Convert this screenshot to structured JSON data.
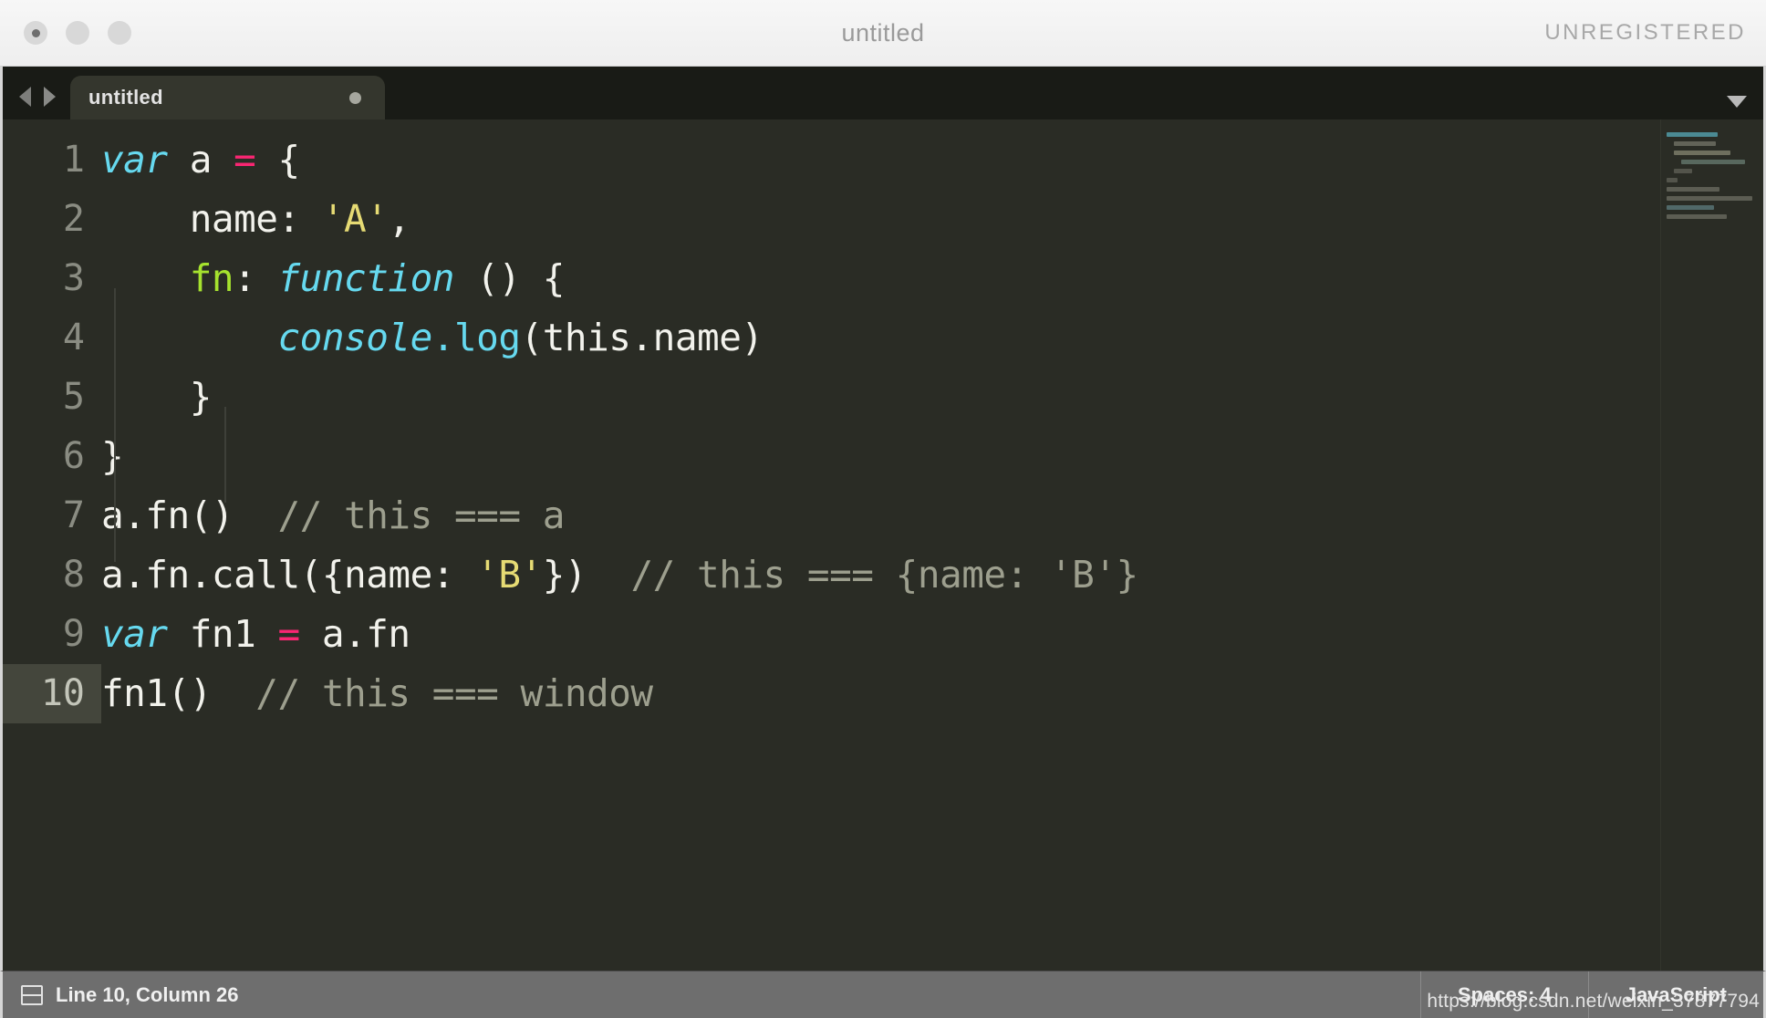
{
  "window": {
    "title": "untitled",
    "license_badge": "UNREGISTERED",
    "traffic_lights": [
      "close-button",
      "minimize-button",
      "maximize-button"
    ]
  },
  "tabbar": {
    "nav_back_icon": "arrow-left-icon",
    "nav_forward_icon": "arrow-right-icon",
    "tabs": [
      {
        "label": "untitled",
        "dirty": true
      }
    ],
    "overflow_icon": "chevron-down-icon"
  },
  "editor": {
    "active_line": 10,
    "lines": [
      {
        "number": "1",
        "text": "var a = {"
      },
      {
        "number": "2",
        "text": "    name: 'A',"
      },
      {
        "number": "3",
        "text": "    fn: function () {"
      },
      {
        "number": "4",
        "text": "        console.log(this.name)"
      },
      {
        "number": "5",
        "text": "    }"
      },
      {
        "number": "6",
        "text": "}"
      },
      {
        "number": "7",
        "text": "a.fn()  // this === a"
      },
      {
        "number": "8",
        "text": "a.fn.call({name: 'B'})  // this === {name: 'B'}"
      },
      {
        "number": "9",
        "text": "var fn1 = a.fn"
      },
      {
        "number": "10",
        "text": "fn1()  // this === window"
      }
    ],
    "colors": {
      "background": "#2a2c25",
      "foreground": "#f2f2ec",
      "keyword": "#66d9ef",
      "function_name": "#a6e22e",
      "operator": "#f92672",
      "string": "#e6db74",
      "comment": "#9d9f8e",
      "gutter": "#8a8c82",
      "active_line_gutter_bg": "#44463c"
    }
  },
  "statusbar": {
    "panel_icon": "panel-layout-icon",
    "cursor_position": "Line 10, Column 26",
    "indentation": "Spaces: 4",
    "syntax": "JavaScript"
  },
  "watermark": {
    "url": "https://blog.csdn.net/weixin_37877794"
  }
}
